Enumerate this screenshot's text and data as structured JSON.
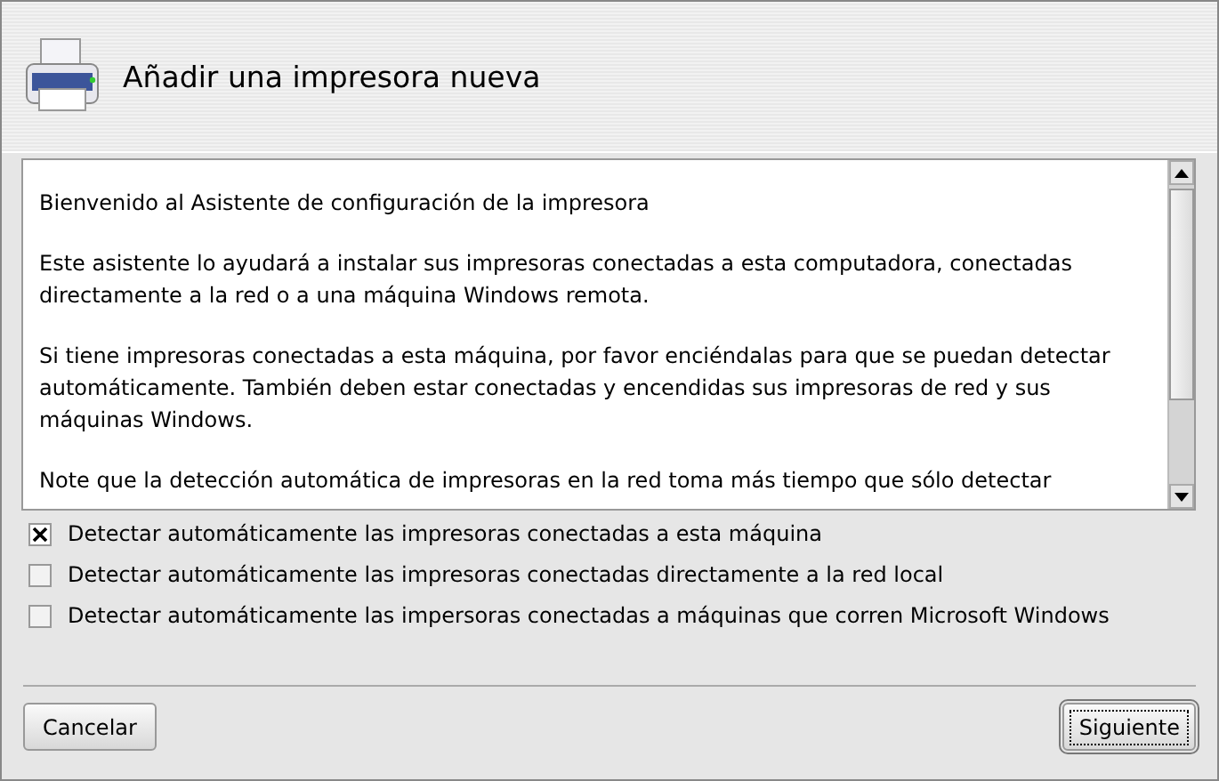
{
  "window": {
    "title": "Añadir una impresora nueva"
  },
  "welcome": {
    "paragraphs": [
      "Bienvenido al Asistente de configuración de la impresora",
      "Este asistente lo ayudará a instalar sus impresoras conectadas a esta computadora, conectadas directamente a la red o a una máquina Windows remota.",
      "Si tiene impresoras conectadas a esta máquina, por favor enciéndalas para que se puedan detectar automáticamente. También deben estar conectadas y encendidas sus impresoras de red y sus máquinas Windows.",
      "Note que la detección automática de impresoras en la red toma más tiempo que sólo detectar"
    ]
  },
  "options": [
    {
      "label": "Detectar automáticamente las impresoras conectadas a esta máquina",
      "checked": true
    },
    {
      "label": "Detectar automáticamente las impresoras conectadas directamente a la red local",
      "checked": false
    },
    {
      "label": "Detectar automáticamente las impersoras conectadas a máquinas que corren Microsoft Windows",
      "checked": false
    }
  ],
  "buttons": [
    {
      "label": "Cancelar",
      "focused": false
    },
    {
      "label": "Siguiente",
      "focused": true
    }
  ]
}
